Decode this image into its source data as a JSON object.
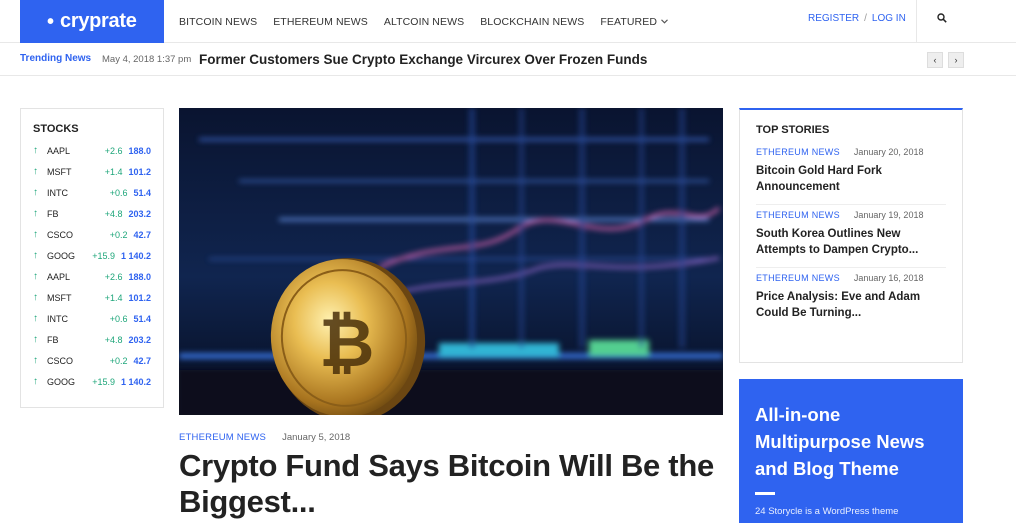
{
  "header": {
    "logo": "cryprate",
    "logo_dot": "•",
    "nav": [
      "BITCOIN NEWS",
      "ETHEREUM NEWS",
      "ALTCOIN NEWS",
      "BLOCKCHAIN NEWS",
      "FEATURED"
    ],
    "register": "REGISTER",
    "separator": "/",
    "login": "LOG IN",
    "icons": [
      "chevron-down-icon",
      "search-icon"
    ]
  },
  "trending": {
    "label": "Trending News",
    "date": "May 4, 2018 1:37 pm",
    "title": "Former Customers Sue Crypto Exchange Vircurex Over Frozen Funds",
    "prev": "‹",
    "next": "›"
  },
  "stocks": {
    "title": "STOCKS",
    "arrow": "↑",
    "rows": [
      {
        "symbol": "AAPL",
        "change": "+2.6",
        "price": "188.0"
      },
      {
        "symbol": "MSFT",
        "change": "+1.4",
        "price": "101.2"
      },
      {
        "symbol": "INTC",
        "change": "+0.6",
        "price": "51.4"
      },
      {
        "symbol": "FB",
        "change": "+4.8",
        "price": "203.2"
      },
      {
        "symbol": "CSCO",
        "change": "+0.2",
        "price": "42.7"
      },
      {
        "symbol": "GOOG",
        "change": "+15.9",
        "price": "1 140.2"
      },
      {
        "symbol": "AAPL",
        "change": "+2.6",
        "price": "188.0"
      },
      {
        "symbol": "MSFT",
        "change": "+1.4",
        "price": "101.2"
      },
      {
        "symbol": "INTC",
        "change": "+0.6",
        "price": "51.4"
      },
      {
        "symbol": "FB",
        "change": "+4.8",
        "price": "203.2"
      },
      {
        "symbol": "CSCO",
        "change": "+0.2",
        "price": "42.7"
      },
      {
        "symbol": "GOOG",
        "change": "+15.9",
        "price": "1 140.2"
      }
    ],
    "colors": {
      "up": "#1ea67a",
      "price": "#2f63f0"
    }
  },
  "hero": {
    "category": "ETHEREUM NEWS",
    "date": "January 5, 2018",
    "title": "Crypto Fund Says Bitcoin Will Be the Biggest...",
    "coin_symbol": "₿"
  },
  "top_stories": {
    "title": "TOP STORIES",
    "items": [
      {
        "category": "ETHEREUM NEWS",
        "date": "January 20, 2018",
        "title": "Bitcoin Gold Hard Fork Announcement"
      },
      {
        "category": "ETHEREUM NEWS",
        "date": "January 19, 2018",
        "title": "South Korea Outlines New Attempts to Dampen Crypto..."
      },
      {
        "category": "ETHEREUM NEWS",
        "date": "January 16, 2018",
        "title": "Price Analysis: Eve and Adam Could Be Turning..."
      }
    ]
  },
  "promo": {
    "title": "All-in-one Multipurpose News and Blog Theme",
    "text": "24 Storycle is a WordPress theme"
  },
  "theme": {
    "accent": "#2f63f0",
    "text": "#222222",
    "muted": "#666666"
  }
}
